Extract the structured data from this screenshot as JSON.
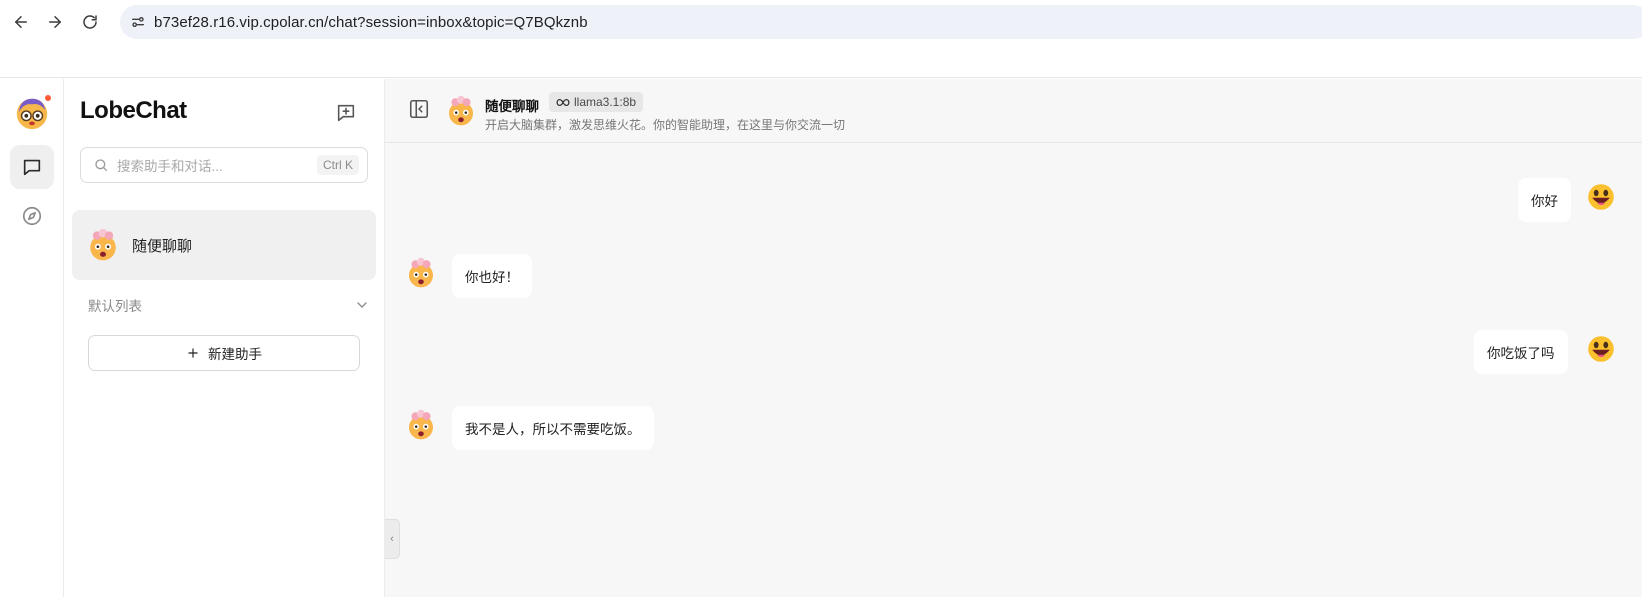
{
  "browser": {
    "url": "b73ef28.r16.vip.cpolar.cn/chat?session=inbox&topic=Q7BQkznb"
  },
  "sidebar": {
    "brand": "LobeChat",
    "search": {
      "placeholder": "搜索助手和对话...",
      "shortcut": "Ctrl K"
    },
    "sessions": [
      {
        "title": "随便聊聊",
        "active": true
      }
    ],
    "group_label": "默认列表",
    "new_assistant_label": "新建助手"
  },
  "chat": {
    "title": "随便聊聊",
    "model": "llama3.1:8b",
    "description": "开启大脑集群，激发思维火花。你的智能助理，在这里与你交流一切",
    "messages": [
      {
        "role": "user",
        "text": "你好"
      },
      {
        "role": "assistant",
        "text": "你也好！"
      },
      {
        "role": "user",
        "text": "你吃饭了吗"
      },
      {
        "role": "assistant",
        "text": "我不是人，所以不需要吃饭。"
      }
    ]
  },
  "icons": {
    "back": "arrow-left-icon",
    "forward": "arrow-right-icon",
    "reload": "reload-icon",
    "site_settings": "site-settings-icon",
    "chat": "chat-bubble-icon",
    "discover": "compass-icon",
    "new_topic": "new-chat-icon",
    "search": "search-icon",
    "chevron": "chevron-down-icon",
    "plus": "plus-icon",
    "panel": "panel-toggle-icon",
    "model": "meta-infinity-icon"
  },
  "colors": {
    "notification_dot": "#ff5a36",
    "active_item_bg": "#f0f0f0",
    "chat_bg": "#f7f7f7"
  }
}
